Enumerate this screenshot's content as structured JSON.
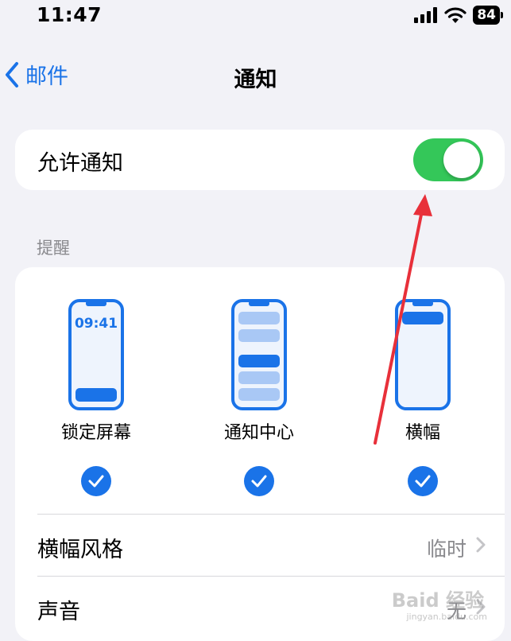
{
  "status_bar": {
    "time": "11:47",
    "battery": "84"
  },
  "nav": {
    "back_label": "邮件",
    "title": "通知"
  },
  "allow": {
    "label": "允许通知",
    "enabled": true
  },
  "alerts": {
    "header": "提醒",
    "lock_time": "09:41",
    "items": [
      {
        "label": "锁定屏幕",
        "checked": true
      },
      {
        "label": "通知中心",
        "checked": true
      },
      {
        "label": "横幅",
        "checked": true
      }
    ]
  },
  "rows": [
    {
      "label": "横幅风格",
      "value": "临时"
    },
    {
      "label": "声音",
      "value": "无"
    }
  ],
  "colors": {
    "accent": "#1a73e8",
    "toggle_on": "#34c759",
    "annotation": "#e8303a"
  },
  "watermark": {
    "text": "Baid 经验",
    "sub": "jingyan.baidu.com"
  }
}
